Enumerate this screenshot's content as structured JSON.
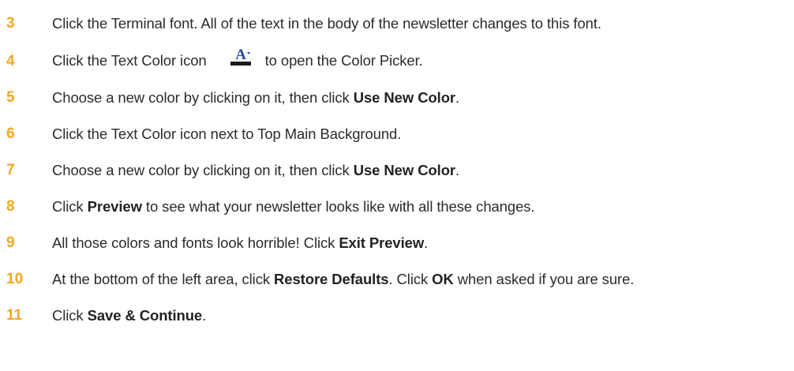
{
  "steps": [
    {
      "num": "3",
      "text": "Click the Terminal font. All of the text in the body of the newsletter changes to this font."
    },
    {
      "num": "4",
      "before": "Click the Text Color icon",
      "icon": "text-color-icon",
      "after": "to open the Color Picker."
    },
    {
      "num": "5",
      "before": "Choose a new color by clicking on it, then click ",
      "bold": "Use New Color",
      "after": "."
    },
    {
      "num": "6",
      "text": "Click the Text Color icon next to Top Main Background."
    },
    {
      "num": "7",
      "before": "Choose a new color by clicking on it, then click ",
      "bold": "Use New Color",
      "after": "."
    },
    {
      "num": "8",
      "before": "Click ",
      "bold": "Preview",
      "after": " to see what your newsletter looks like with all these changes."
    },
    {
      "num": "9",
      "before": "All those colors and fonts look horrible! Click ",
      "bold": "Exit Preview",
      "after": "."
    },
    {
      "num": "10",
      "before": "At the bottom of the left area, click ",
      "bold": "Restore Defaults",
      "middle": ". Click ",
      "bold2": "OK",
      "after": " when asked if you are sure."
    },
    {
      "num": "11",
      "before": "Click ",
      "bold": "Save & Continue",
      "after": "."
    }
  ],
  "colors": {
    "step_number": "#f5a623",
    "body_text": "#2b2b2b",
    "icon_blue": "#1f4e9b"
  }
}
